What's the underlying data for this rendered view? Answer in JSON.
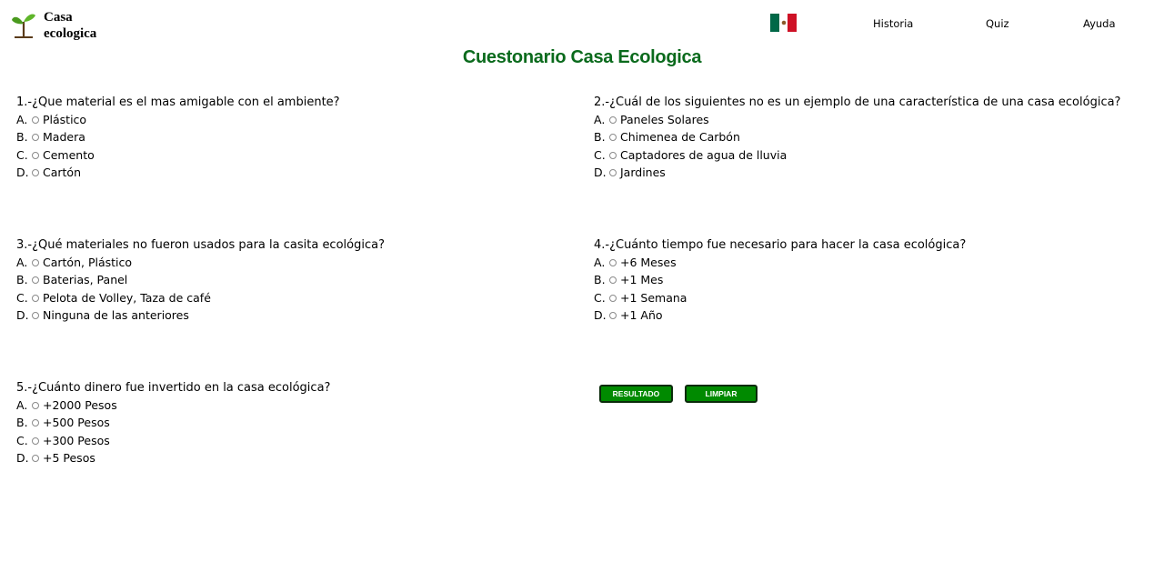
{
  "brand": {
    "name": "Casa ecologica",
    "flag_colors": [
      "#006847",
      "#ffffff",
      "#ce1126"
    ]
  },
  "nav": {
    "historia": "Historia",
    "quiz": "Quiz",
    "ayuda": "Ayuda"
  },
  "title": "Cuestonario Casa Ecologica",
  "questions": [
    {
      "text": "1.-¿Que material es el mas amigable con el ambiente?",
      "options": [
        {
          "letter": "A.",
          "label": "Plástico"
        },
        {
          "letter": "B.",
          "label": "Madera"
        },
        {
          "letter": "C.",
          "label": "Cemento"
        },
        {
          "letter": "D.",
          "label": "Cartón"
        }
      ]
    },
    {
      "text": "2.-¿Cuál de los siguientes no es un ejemplo de una característica de una casa ecológica?",
      "options": [
        {
          "letter": "A.",
          "label": "Paneles Solares"
        },
        {
          "letter": "B.",
          "label": "Chimenea de Carbón"
        },
        {
          "letter": "C.",
          "label": "Captadores de agua de lluvia"
        },
        {
          "letter": "D.",
          "label": "Jardines"
        }
      ]
    },
    {
      "text": "3.-¿Qué materiales no fueron usados para la casita ecológica?",
      "options": [
        {
          "letter": "A.",
          "label": "Cartón, Plástico"
        },
        {
          "letter": "B.",
          "label": "Baterias, Panel"
        },
        {
          "letter": "C.",
          "label": "Pelota de Volley, Taza de café"
        },
        {
          "letter": "D.",
          "label": "Ninguna de las anteriores"
        }
      ]
    },
    {
      "text": "4.-¿Cuánto tiempo fue necesario para hacer la casa ecológica?",
      "options": [
        {
          "letter": "A.",
          "label": "+6 Meses"
        },
        {
          "letter": "B.",
          "label": "+1 Mes"
        },
        {
          "letter": "C.",
          "label": "+1 Semana"
        },
        {
          "letter": "D.",
          "label": "+1 Año"
        }
      ]
    },
    {
      "text": "5.-¿Cuánto dinero fue invertido en la casa ecológica?",
      "options": [
        {
          "letter": "A.",
          "label": "+2000 Pesos"
        },
        {
          "letter": "B.",
          "label": "+500 Pesos"
        },
        {
          "letter": "C.",
          "label": "+300 Pesos"
        },
        {
          "letter": "D.",
          "label": "+5 Pesos"
        }
      ]
    }
  ],
  "buttons": {
    "resultado": "RESULTADO",
    "limpiar": "LIMPIAR"
  }
}
